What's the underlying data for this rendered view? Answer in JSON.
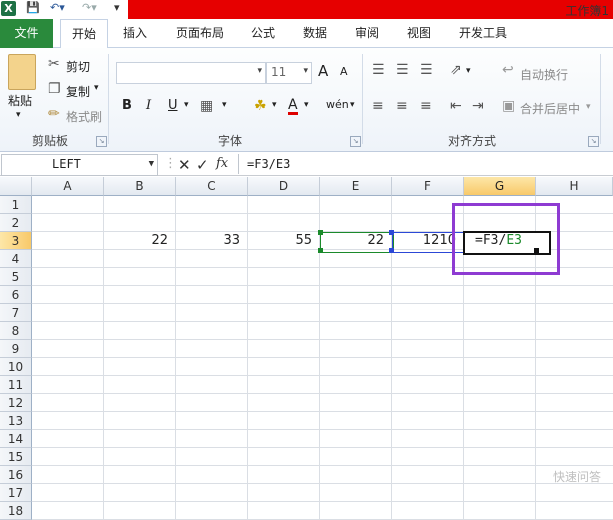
{
  "window": {
    "title": "工作簿1",
    "app_icon": "X"
  },
  "qat": {
    "save_icon": "save-icon",
    "undo_icon": "undo-icon",
    "redo_icon": "redo-icon"
  },
  "tabs": [
    {
      "label": "文件"
    },
    {
      "label": "开始"
    },
    {
      "label": "插入"
    },
    {
      "label": "页面布局"
    },
    {
      "label": "公式"
    },
    {
      "label": "数据"
    },
    {
      "label": "审阅"
    },
    {
      "label": "视图"
    },
    {
      "label": "开发工具"
    }
  ],
  "ribbon": {
    "clipboard": {
      "paste": "粘贴",
      "cut": "剪切",
      "copy": "复制",
      "format_painter": "格式刷",
      "label": "剪贴板"
    },
    "font": {
      "name": "",
      "size": "11",
      "bold": "B",
      "italic": "I",
      "underline": "U",
      "grow": "A",
      "shrink": "A",
      "color": "A",
      "wen": "wén",
      "label": "字体"
    },
    "alignment": {
      "wrap": "自动换行",
      "merge": "合并后居中",
      "label": "对齐方式"
    }
  },
  "formula_bar": {
    "name_box": "LEFT",
    "formula": "=F3/E3",
    "fx": "fx"
  },
  "grid": {
    "columns": [
      "A",
      "B",
      "C",
      "D",
      "E",
      "F",
      "G",
      "H"
    ],
    "rows": [
      "1",
      "2",
      "3",
      "4",
      "5",
      "6",
      "7",
      "8",
      "9",
      "10",
      "11",
      "12",
      "13",
      "14",
      "15",
      "16",
      "17",
      "18"
    ],
    "row3": {
      "B": "22",
      "C": "33",
      "D": "55",
      "E": "22",
      "F": "1210"
    },
    "editing_cell": {
      "prefix": "=F3/",
      "ref": "E3"
    }
  },
  "colors": {
    "file_tab": "#2a8a3c",
    "title_band": "#e60000",
    "highlight": "#8e3bd2",
    "ref_e3": "#1b8a2b",
    "ref_f3": "#2c48d6"
  },
  "watermark": "快速问答"
}
